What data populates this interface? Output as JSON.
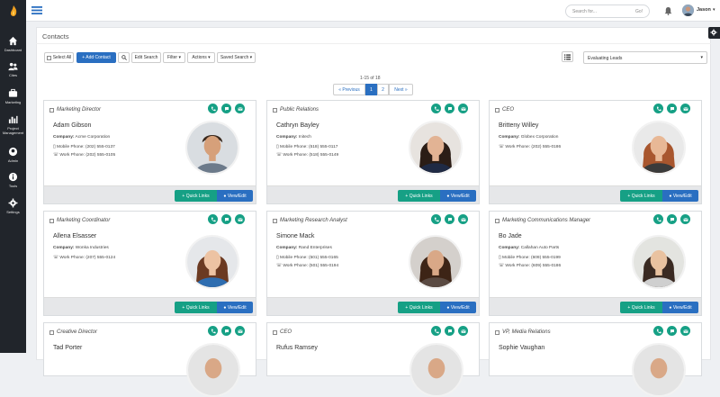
{
  "colors": {
    "sidebar": "#21252b",
    "accent_blue": "#2a6fc1",
    "accent_green": "#16a085"
  },
  "nav": [
    {
      "label": "Dashboard",
      "icon": "home-icon"
    },
    {
      "label": "Cites",
      "icon": "users-icon"
    },
    {
      "label": "Marketing",
      "icon": "briefcase-icon"
    },
    {
      "label": "Project Management",
      "icon": "bar-chart-icon"
    },
    {
      "label": "Admin",
      "icon": "user-circle-icon"
    },
    {
      "label": "Tools",
      "icon": "info-icon"
    },
    {
      "label": "Settings",
      "icon": "gear-icon"
    }
  ],
  "topbar": {
    "search_placeholder": "Search for...",
    "search_go": "Go!",
    "user_name": "Jason"
  },
  "page": {
    "title": "Contacts"
  },
  "toolbar": {
    "select_all": "Select All",
    "add_contact": "+ Add Contact",
    "edit_search": "Edit Search",
    "filter": "Filter",
    "actions": "Actions",
    "saved_search": "Saved Search"
  },
  "filter_select": {
    "value": "Evaluating Leads"
  },
  "pagination": {
    "count": "1-15 of 18",
    "prev": "« Previous",
    "page1": "1",
    "page2": "2",
    "next": "Next »"
  },
  "card_buttons": {
    "quick_links": "+ Quick Links",
    "view_edit": "View/Edit"
  },
  "contacts": [
    {
      "title": "Marketing Director",
      "name": "Adam Gibson",
      "company_label": "Company:",
      "company": "Acme Corporation",
      "mobile": "Mobile Phone: (202) 555-0137",
      "work": "Work Phone: (202) 555-0105"
    },
    {
      "title": "Public Relations",
      "name": "Cathryn Bayley",
      "company_label": "Company:",
      "company": "Initech",
      "mobile": "Mobile Phone: (518) 555-0117",
      "work": "Work Phone: (518) 555-0149"
    },
    {
      "title": "CEO",
      "name": "Britteny Willey",
      "company_label": "Company:",
      "company": "Globex Corporation",
      "mobile": "",
      "work": "Work Phone: (202) 555-0186"
    },
    {
      "title": "Marketing Coordinator",
      "name": "Allena Elsasser",
      "company_label": "Company:",
      "company": "Wonka Industries",
      "mobile": "",
      "work": "Work Phone: (207) 555-0124"
    },
    {
      "title": "Marketing Research Analyst",
      "name": "Simone Mack",
      "company_label": "Company:",
      "company": "Rand Enterprises",
      "mobile": "Mobile Phone: (501) 555-0165",
      "work": "Work Phone: (501) 555-0194"
    },
    {
      "title": "Marketing Communications Manager",
      "name": "Bo Jade",
      "company_label": "Company:",
      "company": "Callahan Auto Parts",
      "mobile": "Mobile Phone: (609) 555-0199",
      "work": "Work Phone: (609) 555-0186"
    },
    {
      "title": "Creative Director",
      "name": "Tad Porter"
    },
    {
      "title": "CEO",
      "name": "Rufus Ramsey"
    },
    {
      "title": "VP, Media Relations",
      "name": "Sophie Vaughan"
    }
  ]
}
